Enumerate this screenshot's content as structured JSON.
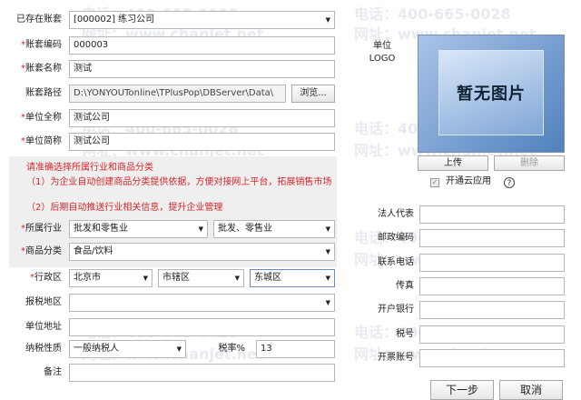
{
  "watermark": {
    "phone": "电话：400-665-0028",
    "site": "网址：www.chanjet.net"
  },
  "existing_account": {
    "label": "已存在账套",
    "value": "[000002] 练习公司"
  },
  "form": {
    "code": {
      "label": "账套编码",
      "value": "000003"
    },
    "name": {
      "label": "账套名称",
      "value": "测试"
    },
    "path": {
      "label": "账套路径",
      "value": "D:\\YONYOUTonline\\TPlusPop\\DBServer\\Data\\",
      "browse": "浏览..."
    },
    "full_name": {
      "label": "单位全称",
      "value": "测试公司"
    },
    "short_name": {
      "label": "单位简称",
      "value": "测试公司"
    },
    "industry": {
      "label": "所属行业",
      "value": "批发和零售业",
      "sub_value": "批发、零售业"
    },
    "category": {
      "label": "商品分类",
      "value": "食品/饮料"
    },
    "region": {
      "label": "行政区",
      "province": "北京市",
      "district": "市辖区",
      "county": "东城区"
    },
    "tax_region": {
      "label": "报税地区",
      "value": ""
    },
    "address": {
      "label": "单位地址",
      "value": ""
    },
    "taxpayer": {
      "label": "纳税性质",
      "value": "一般纳税人",
      "rate_label": "税率%",
      "rate_value": "13"
    },
    "remark": {
      "label": "备注",
      "value": ""
    }
  },
  "notice": {
    "title": "请准确选择所属行业和商品分类",
    "line1": "（1）为企业自动创建商品分类提供依据，方便对接网上平台，拓展销售市场",
    "line2": "（2）后期自动推送行业相关信息，提升企业管理"
  },
  "logo": {
    "label_line1": "单位",
    "label_line2": "LOGO",
    "placeholder": "暂无图片",
    "upload": "上传",
    "delete": "删除",
    "cloud_label": "开通云应用",
    "help": "?"
  },
  "right_fields": [
    {
      "label": "法人代表",
      "value": ""
    },
    {
      "label": "邮政编码",
      "value": ""
    },
    {
      "label": "联系电话",
      "value": ""
    },
    {
      "label": "传真",
      "value": ""
    },
    {
      "label": "开户银行",
      "value": ""
    },
    {
      "label": "税号",
      "value": ""
    },
    {
      "label": "开票账号",
      "value": ""
    }
  ],
  "footer": {
    "next": "下一步",
    "cancel": "取消"
  }
}
